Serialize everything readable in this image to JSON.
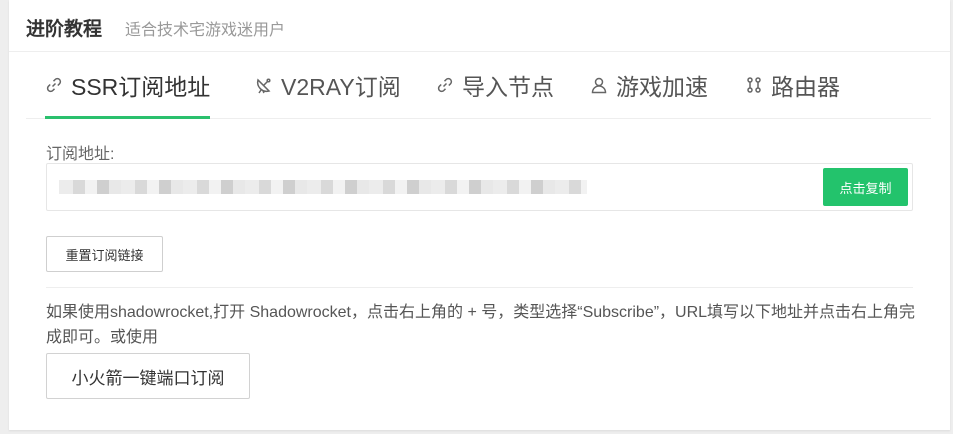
{
  "header": {
    "title": "进阶教程",
    "subtitle": "适合技术宅游戏迷用户"
  },
  "tabs": [
    {
      "label": "SSR订阅地址",
      "icon": "link-icon",
      "active": true
    },
    {
      "label": "V2RAY订阅",
      "icon": "satellite-dish-icon",
      "active": false
    },
    {
      "label": "导入节点",
      "icon": "link-icon",
      "active": false
    },
    {
      "label": "游戏加速",
      "icon": "user-icon",
      "active": false
    },
    {
      "label": "路由器",
      "icon": "router-icon",
      "active": false
    }
  ],
  "subscription": {
    "label": "订阅地址:",
    "copy_button": "点击复制",
    "reset_button": "重置订阅链接"
  },
  "instructions": {
    "text": "如果使用shadowrocket,打开 Shadowrocket，点击右上角的 + 号，类型选择“Subscribe”，URL填写以下地址并点击右上角完成即可。或使用",
    "rocket_button": "小火箭一键端口订阅"
  },
  "colors": {
    "accent": "#23c36c"
  }
}
